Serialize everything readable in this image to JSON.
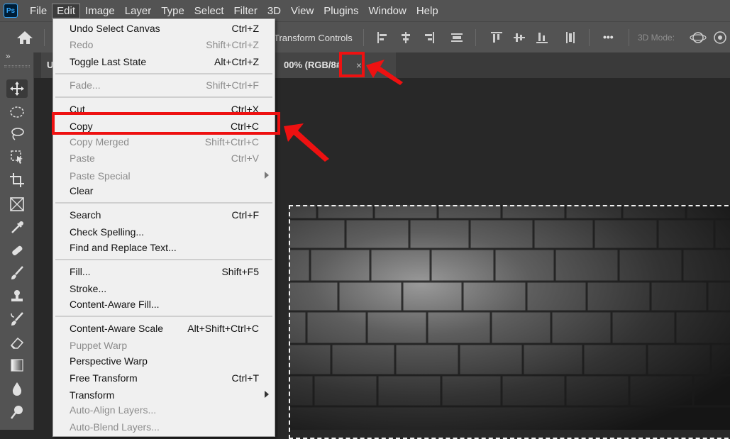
{
  "app": {
    "logo_text": "Ps"
  },
  "menubar": {
    "items": [
      "File",
      "Edit",
      "Image",
      "Layer",
      "Type",
      "Select",
      "Filter",
      "3D",
      "View",
      "Plugins",
      "Window",
      "Help"
    ],
    "active": "Edit"
  },
  "options_bar": {
    "transform_controls_label": "Transform Controls",
    "mode_3d_label": "3D Mode:",
    "more_label": "•••"
  },
  "toolbar": {
    "collapse_label": "»"
  },
  "document_tab": {
    "title_prefix": "U",
    "title": "00% (RGB/8#",
    "close_glyph": "×"
  },
  "edit_menu": {
    "items": [
      {
        "label": "Undo Select Canvas",
        "shortcut": "Ctrl+Z",
        "enabled": true
      },
      {
        "label": "Redo",
        "shortcut": "Shift+Ctrl+Z",
        "enabled": false
      },
      {
        "label": "Toggle Last State",
        "shortcut": "Alt+Ctrl+Z",
        "enabled": true
      },
      {
        "label": "Fade...",
        "shortcut": "Shift+Ctrl+F",
        "enabled": false
      },
      {
        "label": "Cut",
        "shortcut": "Ctrl+X",
        "enabled": true
      },
      {
        "label": "Copy",
        "shortcut": "Ctrl+C",
        "enabled": true,
        "highlighted": true
      },
      {
        "label": "Copy Merged",
        "shortcut": "Shift+Ctrl+C",
        "enabled": false
      },
      {
        "label": "Paste",
        "shortcut": "Ctrl+V",
        "enabled": false
      },
      {
        "label": "Paste Special",
        "shortcut": "",
        "enabled": false,
        "submenu": true
      },
      {
        "label": "Clear",
        "shortcut": "",
        "enabled": true
      },
      {
        "label": "Search",
        "shortcut": "Ctrl+F",
        "enabled": true
      },
      {
        "label": "Check Spelling...",
        "shortcut": "",
        "enabled": true
      },
      {
        "label": "Find and Replace Text...",
        "shortcut": "",
        "enabled": true
      },
      {
        "label": "Fill...",
        "shortcut": "Shift+F5",
        "enabled": true
      },
      {
        "label": "Stroke...",
        "shortcut": "",
        "enabled": true
      },
      {
        "label": "Content-Aware Fill...",
        "shortcut": "",
        "enabled": true
      },
      {
        "label": "Content-Aware Scale",
        "shortcut": "Alt+Shift+Ctrl+C",
        "enabled": true
      },
      {
        "label": "Puppet Warp",
        "shortcut": "",
        "enabled": false
      },
      {
        "label": "Perspective Warp",
        "shortcut": "",
        "enabled": true
      },
      {
        "label": "Free Transform",
        "shortcut": "Ctrl+T",
        "enabled": true
      },
      {
        "label": "Transform",
        "shortcut": "",
        "enabled": true,
        "submenu": true
      },
      {
        "label": "Auto-Align Layers...",
        "shortcut": "",
        "enabled": false
      },
      {
        "label": "Auto-Blend Layers...",
        "shortcut": "",
        "enabled": false
      }
    ]
  },
  "annotations": {
    "color": "#ee1111"
  },
  "colors": {
    "menubar_bg": "#535353",
    "canvas_bg": "#282828",
    "menu_bg": "#f0f0f0",
    "ps_blue": "#31a8ff"
  }
}
